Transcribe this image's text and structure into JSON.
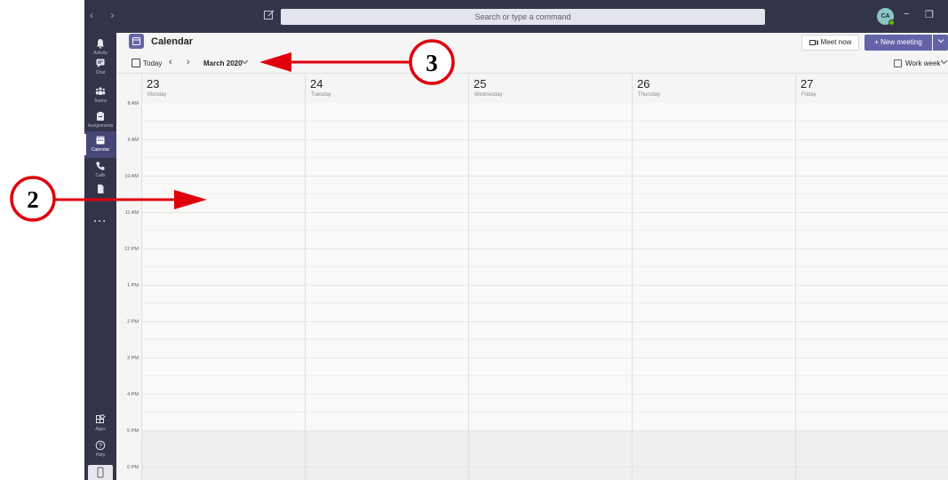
{
  "titlebar": {
    "search_placeholder": "Search or type a command",
    "avatar_initials": "CA",
    "minimize_glyph": "−",
    "restore_glyph": "❐"
  },
  "rail": {
    "items": [
      {
        "label": "Activity",
        "icon": "bell-icon"
      },
      {
        "label": "Chat",
        "icon": "chat-icon"
      },
      {
        "label": "Teams",
        "icon": "teams-icon"
      },
      {
        "label": "Assignments",
        "icon": "assignments-icon"
      },
      {
        "label": "Calendar",
        "icon": "calendar-icon"
      },
      {
        "label": "Calls",
        "icon": "phone-icon"
      },
      {
        "label": "",
        "icon": "files-icon"
      }
    ],
    "more_label": "···",
    "apps_label": "Apps",
    "help_label": "Help"
  },
  "header": {
    "title": "Calendar",
    "meet_now_label": "Meet now",
    "new_meeting_label": "+ New meeting"
  },
  "toolbar": {
    "today_label": "Today",
    "month_label": "March 2020",
    "view_label": "Work week"
  },
  "days": [
    {
      "num": "23",
      "name": "Monday"
    },
    {
      "num": "24",
      "name": "Tuesday"
    },
    {
      "num": "25",
      "name": "Wednesday"
    },
    {
      "num": "26",
      "name": "Thursday"
    },
    {
      "num": "27",
      "name": "Friday"
    }
  ],
  "hours": [
    "8 AM",
    "9 AM",
    "10 AM",
    "11 AM",
    "12 PM",
    "1 PM",
    "2 PM",
    "3 PM",
    "4 PM",
    "5 PM",
    "6 PM"
  ],
  "annotations": {
    "badge_2": "2",
    "badge_3": "3",
    "arrow_color": "#e0000c"
  },
  "colors": {
    "rail_bg": "#33344a",
    "accent": "#6264a7"
  }
}
